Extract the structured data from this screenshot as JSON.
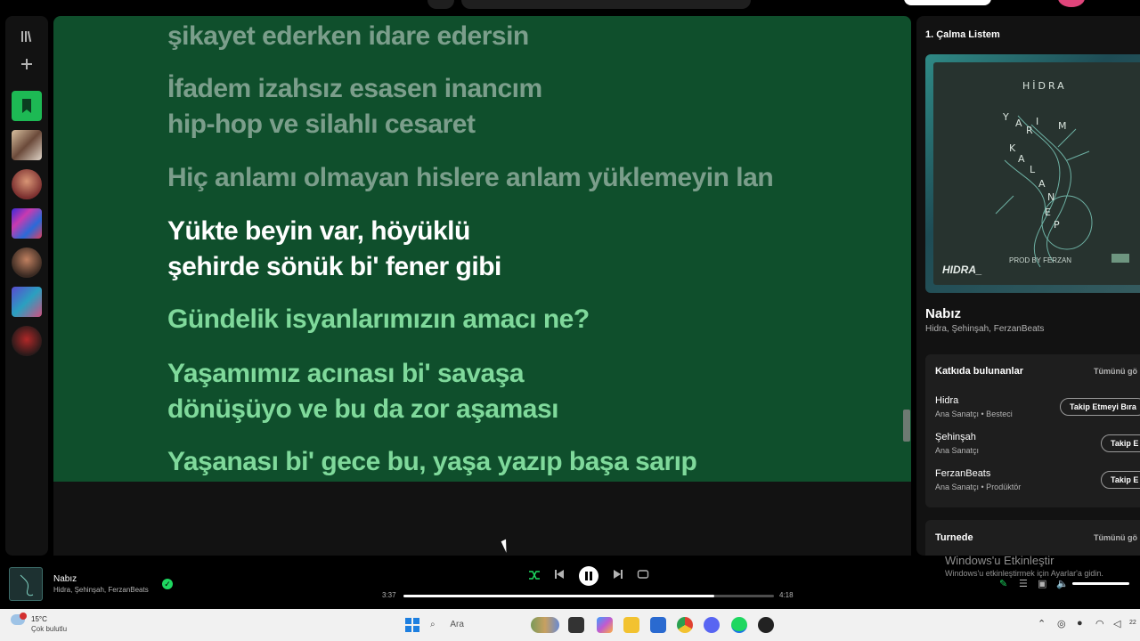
{
  "lyrics": {
    "lines": [
      {
        "text": "şikayet ederken idare edersin",
        "state": "past"
      },
      {
        "text": "İfadem izahsız esasen inancım",
        "state": "past"
      },
      {
        "text": "hip-hop ve silahlı cesaret",
        "state": "past"
      },
      {
        "text": "Hiç anlamı olmayan hislere anlam yüklemeyin lan",
        "state": "past"
      },
      {
        "text": "Yükte beyin var, höyüklü",
        "state": "current"
      },
      {
        "text": "şehirde sönük bi' fener gibi",
        "state": "current"
      },
      {
        "text": "Gündelik isyanlarımızın amacı ne?",
        "state": "future"
      },
      {
        "text": "Yaşamımız acınası bi' savaşa",
        "state": "future"
      },
      {
        "text": "dönüşüyo ve bu da zor aşaması",
        "state": "future"
      },
      {
        "text": "Yaşanası bi' gece bu, yaşa yazıp başa sarıp",
        "state": "future"
      }
    ],
    "background_color": "#0f4f2c"
  },
  "right_panel": {
    "title": "1. Çalma Listem",
    "cover": {
      "artist_text": "HİDRA",
      "prod_text": "PROD BY FERZAN",
      "logo_text": "HIDRA_"
    },
    "song": {
      "name": "Nabız",
      "artists": "Hidra, Şehinşah, FerzanBeats"
    },
    "credits": {
      "title": "Katkıda bulunanlar",
      "show_all": "Tümünü gö",
      "people": [
        {
          "name": "Hidra",
          "role": "Ana Sanatçı • Besteci",
          "button": "Takip Etmeyi Bıra"
        },
        {
          "name": "Şehinşah",
          "role": "Ana Sanatçı",
          "button": "Takip E"
        },
        {
          "name": "FerzanBeats",
          "role": "Ana Sanatçı • Prodüktör",
          "button": "Takip E"
        }
      ]
    },
    "tour": {
      "title": "Turnede",
      "show_all": "Tümünü gö"
    }
  },
  "player": {
    "title": "Nabız",
    "artists": "Hidra, Şehinşah, FerzanBeats",
    "elapsed": "3:37",
    "duration": "4:18",
    "progress_fraction": 0.84,
    "shuffle_on": true
  },
  "watermark": {
    "line1": "Windows'u Etkinleştir",
    "line2": "Windows'u etkinleştirmek için Ayarlar'a gidin."
  },
  "taskbar": {
    "temperature": "15°C",
    "weather": "Çok bulutlu",
    "search_label": "Ara",
    "clock": "22"
  },
  "colors": {
    "accent": "#1ed760",
    "lyrics_bg": "#0f4f2c",
    "future_lyric": "#7fd99b"
  },
  "icons": {
    "library": "library-icon",
    "add": "plus-icon",
    "shuffle": "shuffle-icon",
    "previous": "skip-back-icon",
    "pause": "pause-icon",
    "next": "skip-forward-icon",
    "repeat": "repeat-icon"
  }
}
